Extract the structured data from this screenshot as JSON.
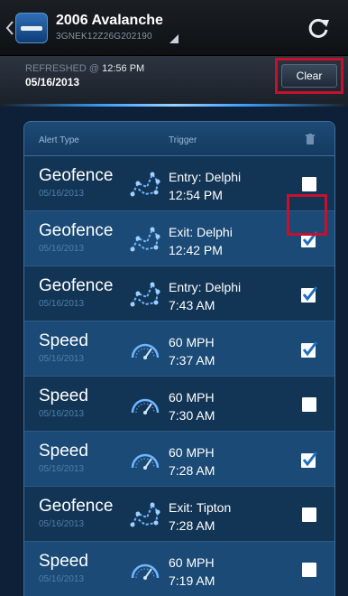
{
  "header": {
    "vehicle_name": "2006 Avalanche",
    "vin": "3GNEK12Z26G202190"
  },
  "refresh": {
    "label": "REFRESHED @",
    "time": "12:56 PM",
    "date": "05/16/2013"
  },
  "clear_label": "Clear",
  "columns": {
    "alert_type": "Alert Type",
    "trigger": "Trigger"
  },
  "alerts": [
    {
      "type": "Geofence",
      "date": "05/16/2013",
      "icon": "geofence-icon",
      "trigger_line1": "Entry: Delphi",
      "trigger_line2": "12:54 PM",
      "checked": false
    },
    {
      "type": "Geofence",
      "date": "05/16/2013",
      "icon": "geofence-icon",
      "trigger_line1": "Exit: Delphi",
      "trigger_line2": "12:42 PM",
      "checked": true
    },
    {
      "type": "Geofence",
      "date": "05/16/2013",
      "icon": "geofence-icon",
      "trigger_line1": "Entry: Delphi",
      "trigger_line2": "7:43 AM",
      "checked": true
    },
    {
      "type": "Speed",
      "date": "05/16/2013",
      "icon": "speedometer-icon",
      "trigger_line1": "60 MPH",
      "trigger_line2": "7:37 AM",
      "checked": true
    },
    {
      "type": "Speed",
      "date": "05/16/2013",
      "icon": "speedometer-icon",
      "trigger_line1": "60 MPH",
      "trigger_line2": "7:30 AM",
      "checked": false
    },
    {
      "type": "Speed",
      "date": "05/16/2013",
      "icon": "speedometer-icon",
      "trigger_line1": "60 MPH",
      "trigger_line2": "7:28 AM",
      "checked": true
    },
    {
      "type": "Geofence",
      "date": "05/16/2013",
      "icon": "geofence-icon",
      "trigger_line1": "Exit: Tipton",
      "trigger_line2": "7:28 AM",
      "checked": false
    },
    {
      "type": "Speed",
      "date": "05/16/2013",
      "icon": "speedometer-icon",
      "trigger_line1": "60 MPH",
      "trigger_line2": "7:19 AM",
      "checked": false
    }
  ],
  "colors": {
    "accent_blue": "#3aa0ff",
    "highlight_red": "#c8102e",
    "panel": "#123556"
  }
}
